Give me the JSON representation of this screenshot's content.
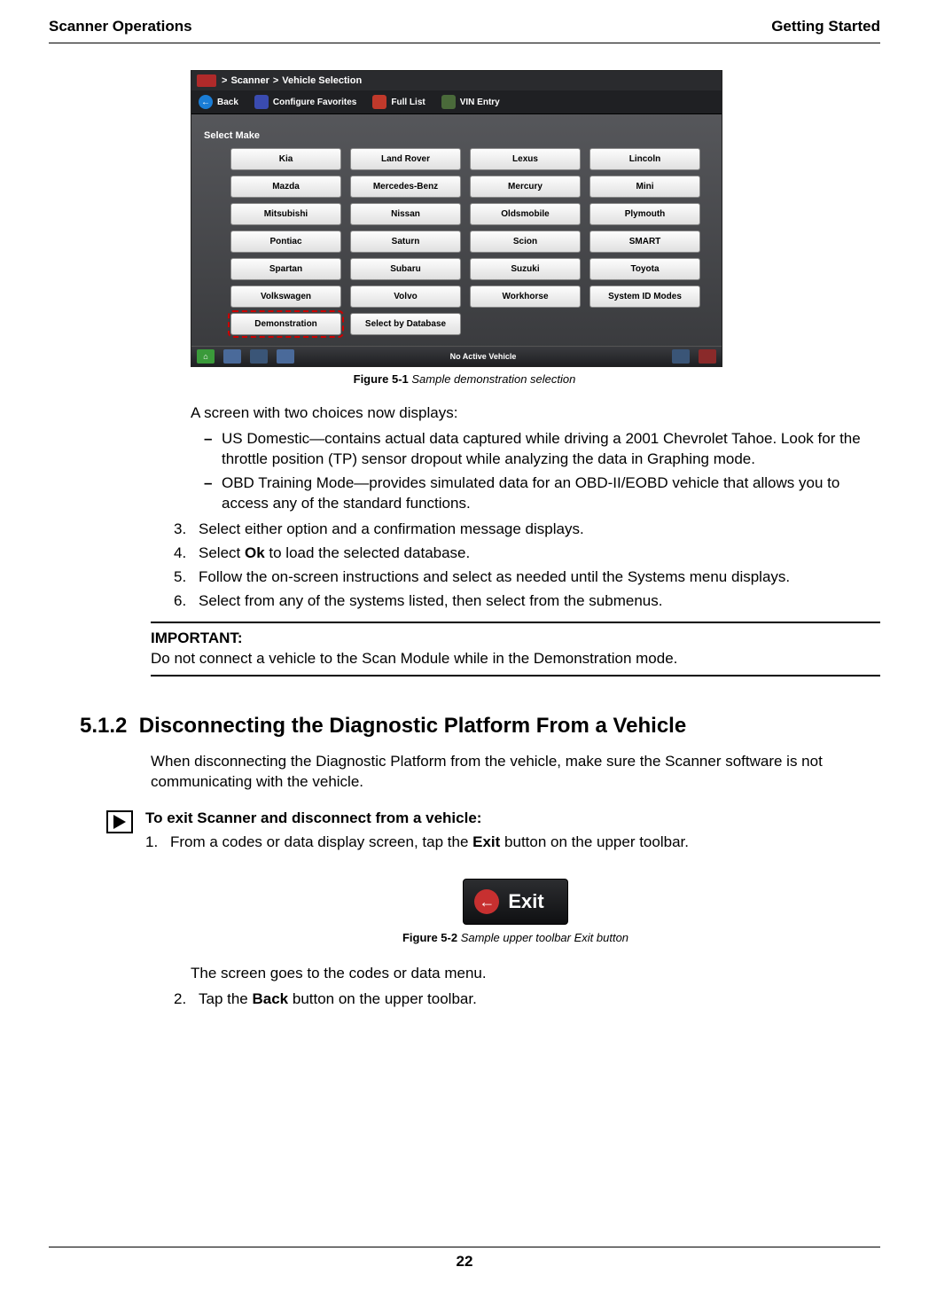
{
  "header": {
    "left": "Scanner Operations",
    "right": "Getting Started"
  },
  "shot1": {
    "breadcrumb": {
      "sep": ">",
      "p1": "Scanner",
      "p2": "Vehicle Selection"
    },
    "toolbar": {
      "back": "Back",
      "conf": "Configure Favorites",
      "full": "Full List",
      "vin": "VIN Entry"
    },
    "select_label": "Select Make",
    "makes": [
      "Kia",
      "Land Rover",
      "Lexus",
      "Lincoln",
      "Mazda",
      "Mercedes-Benz",
      "Mercury",
      "Mini",
      "Mitsubishi",
      "Nissan",
      "Oldsmobile",
      "Plymouth",
      "Pontiac",
      "Saturn",
      "Scion",
      "SMART",
      "Spartan",
      "Subaru",
      "Suzuki",
      "Toyota",
      "Volkswagen",
      "Volvo",
      "Workhorse",
      "System ID Modes",
      "Demonstration",
      "Select by Database"
    ],
    "status": "No Active Vehicle"
  },
  "fig1": {
    "num": "Figure 5-1",
    "cap": " Sample demonstration selection"
  },
  "body": {
    "intro": "A screen with two choices now displays:",
    "dash1": "US Domestic—contains actual data captured while driving a 2001 Chevrolet Tahoe. Look for the throttle position (TP) sensor dropout while analyzing the data in Graphing mode.",
    "dash2": "OBD Training Mode—provides simulated data for an OBD-II/EOBD vehicle that allows you to access any of the standard functions.",
    "s3": "Select either option and a confirmation message displays.",
    "s4a": "Select ",
    "s4b": "Ok",
    "s4c": " to load the selected database.",
    "s5": "Follow the on-screen instructions and select as needed until the Systems menu displays.",
    "s6": "Select from any of the systems listed, then select from the submenus."
  },
  "important": {
    "label": "IMPORTANT:",
    "text": "Do not connect a vehicle to the Scan Module while in the Demonstration mode."
  },
  "h2": {
    "num": "5.1.2",
    "title": "Disconnecting the Diagnostic Platform From a Vehicle"
  },
  "h2p": "When disconnecting the Diagnostic Platform from the vehicle, make sure the Scanner software is not communicating with the vehicle.",
  "proc": {
    "title": "To exit Scanner and disconnect from a vehicle:",
    "s1a": "From a codes or data display screen, tap the ",
    "s1b": "Exit",
    "s1c": " button on the upper toolbar."
  },
  "exit_label": "Exit",
  "fig2": {
    "num": "Figure 5-2",
    "cap": " Sample upper toolbar Exit button"
  },
  "after": {
    "p": "The screen goes to the codes or data menu.",
    "s2a": "Tap the ",
    "s2b": "Back",
    "s2c": " button on the upper toolbar."
  },
  "page": "22"
}
